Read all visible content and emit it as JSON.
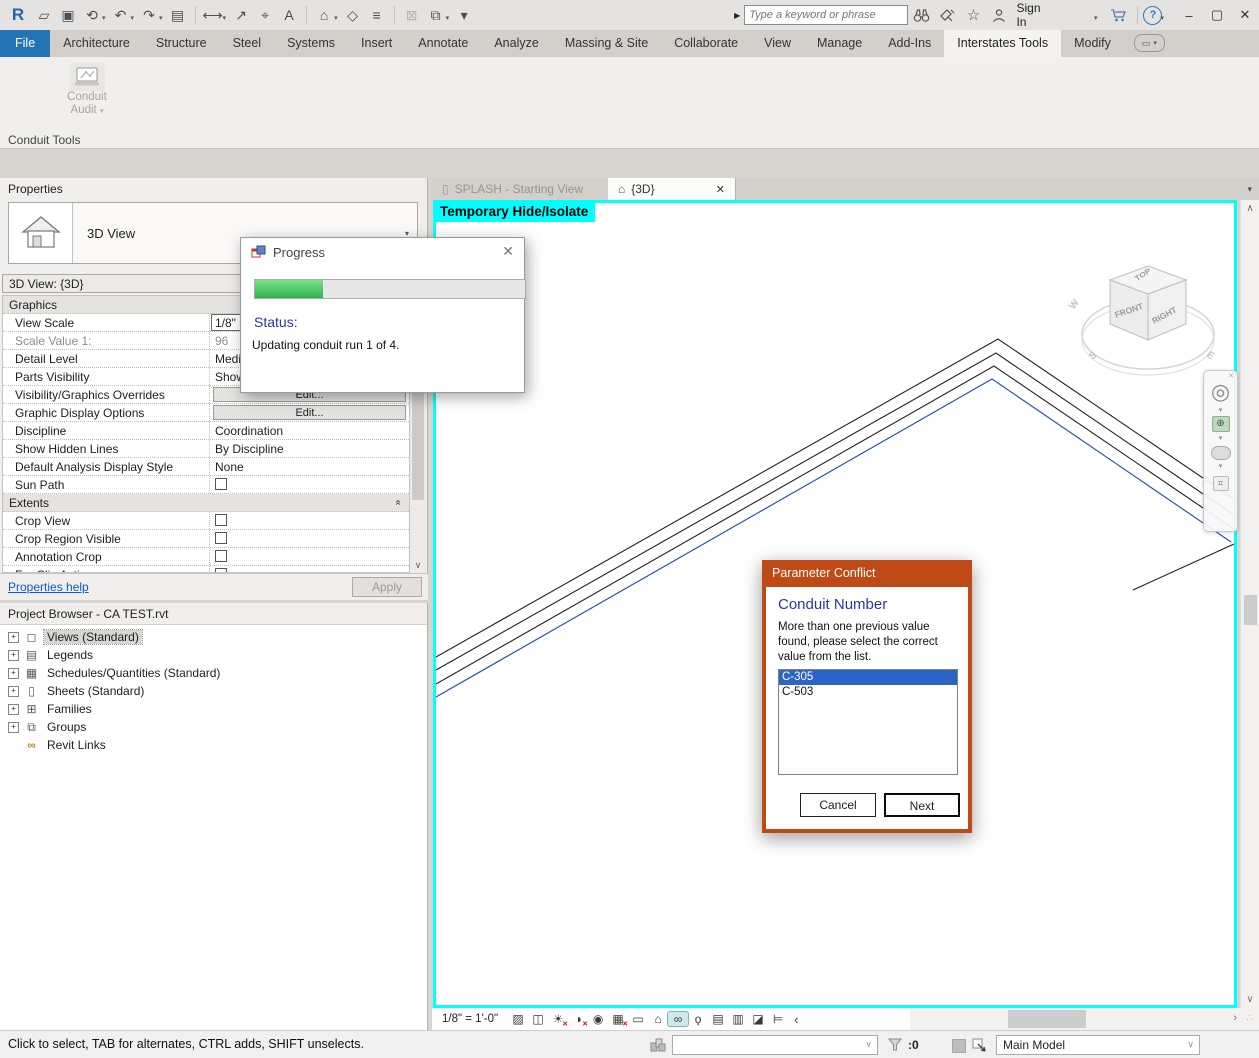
{
  "glyphs": {
    "caret": "▾",
    "dropdown": "∨",
    "expander": "+",
    "up_chevrons": "«",
    "collapse": "‹",
    "scroll_up": "∧",
    "scroll_down": "∨",
    "scroll_right": "›",
    "play": "▶",
    "close": "✕",
    "minimize": "–",
    "maximize": "▢",
    "grip": "∴",
    "toggle": "▭"
  },
  "titlebar": {
    "search_placeholder": "Type a keyword or phrase",
    "sign_in": "Sign In",
    "help_glyph": "?",
    "qat": [
      {
        "name": "revit-logo",
        "glyph": "R"
      },
      {
        "name": "open-icon",
        "glyph": "▱"
      },
      {
        "name": "save-icon",
        "glyph": "▣"
      },
      {
        "name": "sync-icon",
        "glyph": "⟲"
      },
      {
        "name": "undo-icon",
        "glyph": "↶"
      },
      {
        "name": "redo-icon",
        "glyph": "↷"
      },
      {
        "name": "print-icon",
        "glyph": "▤"
      },
      {
        "name": "measure-icon",
        "glyph": "⟷"
      },
      {
        "name": "aligned-dimension-icon",
        "glyph": "↗"
      },
      {
        "name": "tag-icon",
        "glyph": "⌖"
      },
      {
        "name": "text-icon",
        "glyph": "A"
      },
      {
        "name": "default-3d-view-icon",
        "glyph": "⌂"
      },
      {
        "name": "section-icon",
        "glyph": "◇"
      },
      {
        "name": "thin-lines-icon",
        "glyph": "≡"
      },
      {
        "name": "close-inactive-windows-icon",
        "glyph": "⊠"
      },
      {
        "name": "switch-windows-icon",
        "glyph": "⧉"
      },
      {
        "name": "customize-qat-icon",
        "glyph": "▾"
      }
    ]
  },
  "ribbon": {
    "tabs": [
      {
        "label": "File"
      },
      {
        "label": "Architecture"
      },
      {
        "label": "Structure"
      },
      {
        "label": "Steel"
      },
      {
        "label": "Systems"
      },
      {
        "label": "Insert"
      },
      {
        "label": "Annotate"
      },
      {
        "label": "Analyze"
      },
      {
        "label": "Massing & Site"
      },
      {
        "label": "Collaborate"
      },
      {
        "label": "View"
      },
      {
        "label": "Manage"
      },
      {
        "label": "Add-Ins"
      },
      {
        "label": "Interstates Tools"
      },
      {
        "label": "Modify"
      }
    ],
    "conduit_button": {
      "line1": "Conduit",
      "line2": "Audit"
    },
    "panel_label": "Conduit Tools"
  },
  "properties": {
    "title": "Properties",
    "type_name": "3D View",
    "view_title": "3D View: {3D}",
    "rows": [
      {
        "kind": "header",
        "label": "Graphics"
      },
      {
        "kind": "scale",
        "label": "View Scale",
        "value": "1/8\" = 1'-0\""
      },
      {
        "kind": "muted",
        "label": "Scale Value    1:",
        "value": "96"
      },
      {
        "kind": "text",
        "label": "Detail Level",
        "value": "Medium"
      },
      {
        "kind": "text",
        "label": "Parts Visibility",
        "value": "Show Original"
      },
      {
        "kind": "button",
        "label": "Visibility/Graphics Overrides",
        "value": "Edit..."
      },
      {
        "kind": "button",
        "label": "Graphic Display Options",
        "value": "Edit..."
      },
      {
        "kind": "text",
        "label": "Discipline",
        "value": "Coordination"
      },
      {
        "kind": "text",
        "label": "Show Hidden Lines",
        "value": "By Discipline"
      },
      {
        "kind": "text",
        "label": "Default Analysis Display Style",
        "value": "None"
      },
      {
        "kind": "checkbox",
        "label": "Sun Path"
      },
      {
        "kind": "header",
        "label": "Extents"
      },
      {
        "kind": "checkbox",
        "label": "Crop View"
      },
      {
        "kind": "checkbox",
        "label": "Crop Region Visible"
      },
      {
        "kind": "checkbox",
        "label": "Annotation Crop"
      },
      {
        "kind": "checkbox",
        "label": "Far Clip Active"
      }
    ],
    "help_link": "Properties help",
    "apply_label": "Apply"
  },
  "project_browser": {
    "title": "Project Browser - CA TEST.rvt",
    "items": [
      {
        "label": "Views (Standard)",
        "glyph": "◻"
      },
      {
        "label": "Legends",
        "glyph": "▤"
      },
      {
        "label": "Schedules/Quantities (Standard)",
        "glyph": "▦"
      },
      {
        "label": "Sheets (Standard)",
        "glyph": "▯"
      },
      {
        "label": "Families",
        "glyph": "⊞"
      },
      {
        "label": "Groups",
        "glyph": "⧉"
      },
      {
        "label": "Revit Links",
        "glyph": "∞"
      }
    ]
  },
  "view_tabs": {
    "tab1": "SPLASH - Starting View",
    "tab2": "{3D}"
  },
  "canvas": {
    "overlay_label": "Temporary Hide/Isolate",
    "viewcube": {
      "top": "TOP",
      "front": "FRONT",
      "right": "RIGHT",
      "w": "W",
      "s": "S",
      "e": "E"
    },
    "colors": {
      "border": "#00FFFF",
      "line": "#1F1F1F",
      "selected_line": "#2F55A4"
    }
  },
  "view_control_bar": {
    "scale": "1/8\" = 1'-0\"",
    "icons": [
      {
        "name": "visual-style-icon",
        "glyph": "▨"
      },
      {
        "name": "detail-level-icon",
        "glyph": "◫"
      },
      {
        "name": "sun-path-icon",
        "glyph": "☀",
        "badge": "✕"
      },
      {
        "name": "shadows-icon",
        "glyph": "◑",
        "badge": "✕"
      },
      {
        "name": "rendering-dialog-icon",
        "glyph": "◉"
      },
      {
        "name": "crop-view-icon",
        "glyph": "▦",
        "badge": "✕"
      },
      {
        "name": "crop-region-icon",
        "glyph": "▭"
      },
      {
        "name": "lock-3d-view-icon",
        "glyph": "⌂"
      },
      {
        "name": "temporary-hide-isolate-icon",
        "glyph": "∞"
      },
      {
        "name": "reveal-hidden-icon",
        "glyph": "ϙ"
      },
      {
        "name": "temporary-view-properties-icon",
        "glyph": "▤"
      },
      {
        "name": "analytical-model-icon",
        "glyph": "▥"
      },
      {
        "name": "displacement-icon",
        "glyph": "◪"
      },
      {
        "name": "constraints-icon",
        "glyph": "⊨"
      }
    ]
  },
  "status_bar": {
    "hint": "Click to select, TAB for alternates, CTRL adds, SHIFT unselects.",
    "filter_count": ":0",
    "active_workset": "",
    "design_option": "Main Model"
  },
  "progress_dialog": {
    "title": "Progress",
    "percent": 25,
    "status_label": "Status:",
    "status_text": "Updating conduit run 1 of 4."
  },
  "conflict_dialog": {
    "title": "Parameter Conflict",
    "heading": "Conduit Number",
    "message": "More than one previous value found, please select the correct value from the list.",
    "options": [
      "C-305",
      "C-503"
    ],
    "selected_index": 0,
    "cancel_label": "Cancel",
    "next_label": "Next",
    "accent_color": "#C04A16"
  }
}
